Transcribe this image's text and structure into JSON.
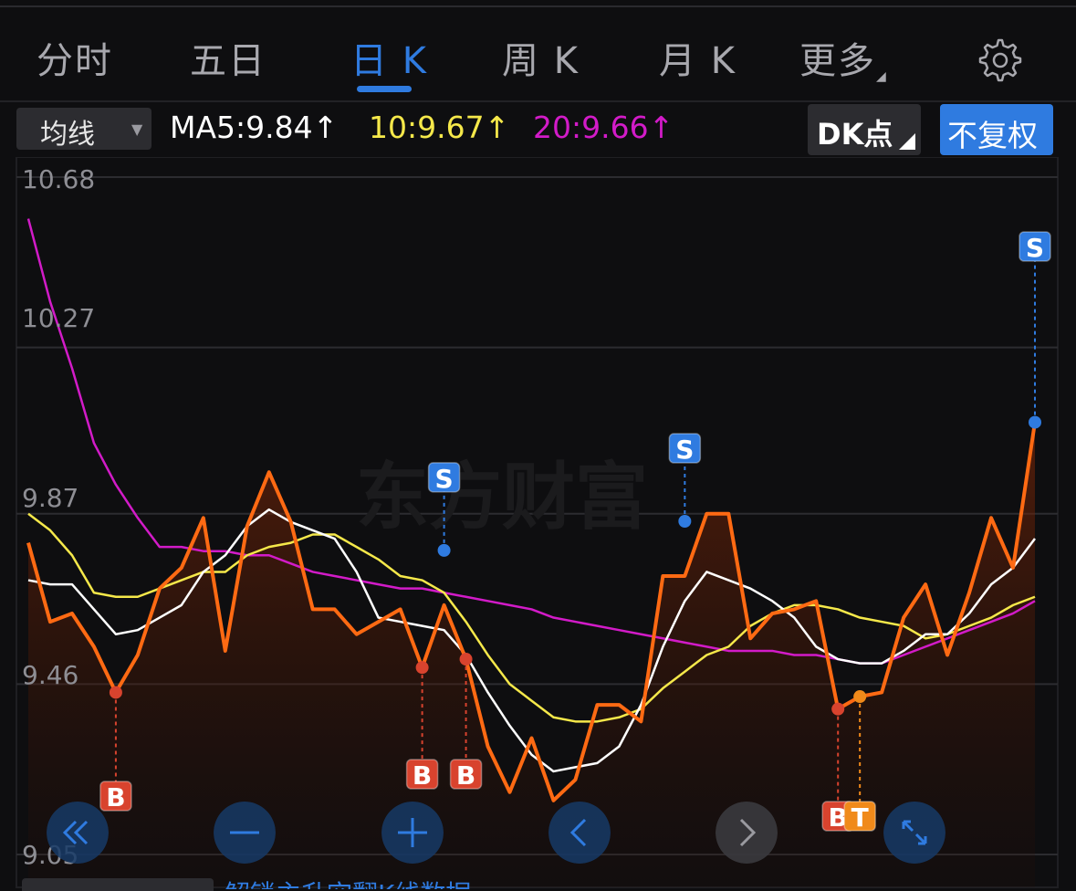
{
  "tabs": [
    {
      "label": "分时"
    },
    {
      "label": "五日"
    },
    {
      "label": "日 K"
    },
    {
      "label": "周 K"
    },
    {
      "label": "月 K"
    },
    {
      "label": "更多"
    }
  ],
  "active_tab_index": 2,
  "indicator": {
    "dropdown_label": "均线",
    "ma5": "MA5:9.84↑",
    "ma10": "10:9.67↑",
    "ma20": "20:9.66↑",
    "ma5_color": "#ffffff",
    "ma10_color": "#f5e84a",
    "ma20_color": "#d21bc8"
  },
  "dk_button": "DK点",
  "fuquan_button": "不复权",
  "watermark": "东方财富",
  "colors": {
    "accent": "#2f7be0",
    "price": "#ff6a13",
    "buy": "#d8432e",
    "sell": "#2f7be0",
    "t": "#f08a1a"
  },
  "chart_data": {
    "type": "line",
    "y_ticks": [
      "10.68",
      "10.27",
      "9.87",
      "9.46",
      "9.05"
    ],
    "ylim": [
      9.05,
      10.68
    ],
    "grid": true,
    "series": [
      {
        "color": "#ff6a13",
        "values": [
          9.8,
          9.61,
          9.63,
          9.55,
          9.44,
          9.53,
          9.69,
          9.74,
          9.86,
          9.54,
          9.84,
          9.97,
          9.85,
          9.64,
          9.64,
          9.58,
          9.61,
          9.64,
          9.5,
          9.65,
          9.52,
          9.31,
          9.2,
          9.33,
          9.18,
          9.23,
          9.41,
          9.41,
          9.37,
          9.72,
          9.72,
          9.87,
          9.87,
          9.57,
          9.63,
          9.64,
          9.66,
          9.4,
          9.43,
          9.44,
          9.62,
          9.7,
          9.53,
          9.68,
          9.86,
          9.74,
          10.09
        ]
      },
      {
        "color": "#ffffff",
        "values": [
          9.71,
          9.7,
          9.7,
          9.64,
          9.58,
          9.59,
          9.62,
          9.65,
          9.73,
          9.77,
          9.84,
          9.88,
          9.85,
          9.83,
          9.81,
          9.73,
          9.62,
          9.61,
          9.6,
          9.59,
          9.53,
          9.44,
          9.36,
          9.29,
          9.25,
          9.26,
          9.27,
          9.31,
          9.41,
          9.55,
          9.66,
          9.73,
          9.71,
          9.69,
          9.66,
          9.62,
          9.55,
          9.52,
          9.51,
          9.51,
          9.54,
          9.58,
          9.58,
          9.63,
          9.7,
          9.74,
          9.81
        ]
      },
      {
        "color": "#f5e84a",
        "values": [
          9.87,
          9.83,
          9.77,
          9.68,
          9.67,
          9.67,
          9.69,
          9.71,
          9.73,
          9.73,
          9.77,
          9.79,
          9.8,
          9.82,
          9.82,
          9.79,
          9.76,
          9.72,
          9.71,
          9.68,
          9.61,
          9.53,
          9.46,
          9.42,
          9.38,
          9.37,
          9.37,
          9.38,
          9.4,
          9.45,
          9.49,
          9.53,
          9.55,
          9.6,
          9.63,
          9.65,
          9.65,
          9.64,
          9.62,
          9.61,
          9.6,
          9.57,
          9.58,
          9.6,
          9.62,
          9.65,
          9.67
        ]
      },
      {
        "color": "#d21bc8",
        "values": [
          10.58,
          10.38,
          10.22,
          10.04,
          9.94,
          9.86,
          9.79,
          9.79,
          9.78,
          9.78,
          9.77,
          9.77,
          9.75,
          9.73,
          9.72,
          9.71,
          9.7,
          9.69,
          9.69,
          9.68,
          9.67,
          9.66,
          9.65,
          9.64,
          9.62,
          9.61,
          9.6,
          9.59,
          9.58,
          9.57,
          9.56,
          9.55,
          9.54,
          9.54,
          9.54,
          9.53,
          9.53,
          9.52,
          9.51,
          9.51,
          9.53,
          9.55,
          9.57,
          9.59,
          9.61,
          9.63,
          9.66
        ]
      }
    ],
    "signals": [
      {
        "label": "B",
        "index": 4
      },
      {
        "label": "B",
        "index": 18
      },
      {
        "label": "B",
        "index": 20
      },
      {
        "label": "S",
        "index": 19
      },
      {
        "label": "S",
        "index": 30
      },
      {
        "label": "B",
        "index": 37
      },
      {
        "label": "T",
        "index": 38
      },
      {
        "label": "S",
        "index": 46
      }
    ]
  },
  "controls": [
    {
      "icon": "double-left-icon"
    },
    {
      "icon": "minus-icon"
    },
    {
      "icon": "plus-icon"
    },
    {
      "icon": "chevron-left-icon"
    },
    {
      "icon": "chevron-right-icon"
    },
    {
      "icon": "expand-icon"
    }
  ],
  "bottom_link": "解锁主升空翻K线数据"
}
